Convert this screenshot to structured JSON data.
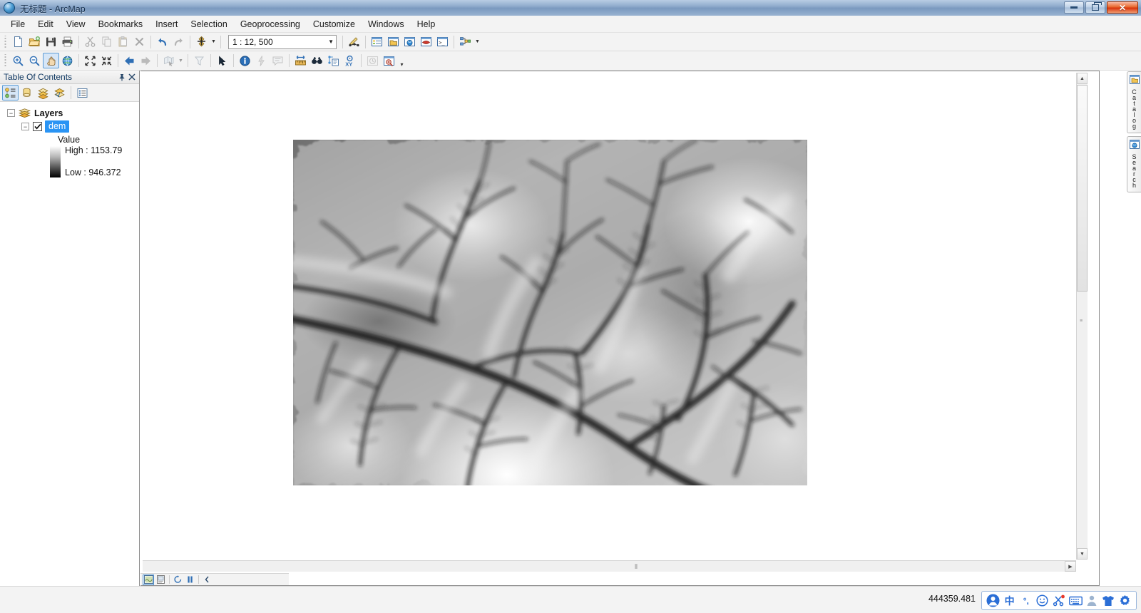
{
  "window": {
    "title": "无标题 - ArcMap",
    "app_icon": "arcmap-globe-icon",
    "controls": {
      "minimize": "minimize-button",
      "restore": "restore-button",
      "close": "✕"
    }
  },
  "menubar": {
    "items": [
      {
        "label": "File"
      },
      {
        "label": "Edit"
      },
      {
        "label": "View"
      },
      {
        "label": "Bookmarks"
      },
      {
        "label": "Insert"
      },
      {
        "label": "Selection"
      },
      {
        "label": "Geoprocessing"
      },
      {
        "label": "Customize"
      },
      {
        "label": "Windows"
      },
      {
        "label": "Help"
      }
    ]
  },
  "toolbars": {
    "standard": {
      "buttons": [
        {
          "name": "new-map-icon",
          "title": "New"
        },
        {
          "name": "open-icon",
          "title": "Open"
        },
        {
          "name": "save-icon",
          "title": "Save"
        },
        {
          "name": "print-icon",
          "title": "Print"
        },
        {
          "name": "cut-icon",
          "title": "Cut"
        },
        {
          "name": "copy-icon",
          "title": "Copy"
        },
        {
          "name": "paste-icon",
          "title": "Paste"
        },
        {
          "name": "delete-icon",
          "title": "Delete"
        },
        {
          "name": "undo-icon",
          "title": "Undo"
        },
        {
          "name": "redo-icon",
          "title": "Redo"
        },
        {
          "name": "add-data-icon",
          "title": "Add Data"
        }
      ],
      "scale": {
        "value": "1 : 12, 500",
        "placeholder": "1 : 12, 500"
      },
      "right_buttons": [
        {
          "name": "editor-toolbar-icon",
          "title": "Editor Toolbar"
        },
        {
          "name": "table-of-contents-icon",
          "title": "Table Of Contents"
        },
        {
          "name": "catalog-window-icon",
          "title": "Catalog Window"
        },
        {
          "name": "search-window-icon",
          "title": "Search Window"
        },
        {
          "name": "arctoolbox-icon",
          "title": "ArcToolbox"
        },
        {
          "name": "python-window-icon",
          "title": "Python Window"
        },
        {
          "name": "modelbuilder-icon",
          "title": "ModelBuilder"
        }
      ]
    },
    "tools": {
      "buttons": [
        {
          "name": "zoom-in-icon",
          "title": "Zoom In"
        },
        {
          "name": "zoom-out-icon",
          "title": "Zoom Out"
        },
        {
          "name": "pan-icon",
          "title": "Pan",
          "active": true
        },
        {
          "name": "full-extent-icon",
          "title": "Full Extent"
        },
        {
          "name": "fixed-zoom-in-icon",
          "title": "Fixed Zoom In"
        },
        {
          "name": "fixed-zoom-out-icon",
          "title": "Fixed Zoom Out"
        },
        {
          "name": "go-back-icon",
          "title": "Go Back To Previous Extent"
        },
        {
          "name": "go-forward-icon",
          "title": "Go To Next Extent"
        },
        {
          "name": "select-features-icon",
          "title": "Select Features"
        },
        {
          "name": "clear-selection-icon",
          "title": "Clear Selected Features"
        },
        {
          "name": "select-elements-icon",
          "title": "Select Elements"
        },
        {
          "name": "identify-icon",
          "title": "Identify"
        },
        {
          "name": "hyperlink-icon",
          "title": "Hyperlink"
        },
        {
          "name": "html-popup-icon",
          "title": "HTML Popup"
        },
        {
          "name": "measure-icon",
          "title": "Measure"
        },
        {
          "name": "find-icon",
          "title": "Find"
        },
        {
          "name": "find-route-icon",
          "title": "Find Route"
        },
        {
          "name": "go-to-xy-icon",
          "title": "Go To XY"
        },
        {
          "name": "time-slider-icon",
          "title": "Time Slider"
        },
        {
          "name": "create-viewer-window-icon",
          "title": "Create Viewer Window"
        }
      ]
    }
  },
  "toc": {
    "title": "Table Of Contents",
    "pin_icon": "pin-icon",
    "close_icon": "close-icon",
    "mode_buttons": [
      {
        "name": "list-by-drawing-order-icon",
        "title": "List By Drawing Order",
        "active": true
      },
      {
        "name": "list-by-source-icon",
        "title": "List By Source"
      },
      {
        "name": "list-by-visibility-icon",
        "title": "List By Visibility"
      },
      {
        "name": "list-by-selection-icon",
        "title": "List By Selection"
      },
      {
        "name": "toc-options-icon",
        "title": "Options"
      }
    ],
    "tree": {
      "root": {
        "label": "Layers",
        "expander": "−"
      },
      "layer": {
        "label": "dem",
        "expander": "−",
        "checked": true,
        "selected": true
      },
      "legend": {
        "value_label": "Value",
        "high_label": "High : 1153.79",
        "low_label": "Low : 946.372",
        "ramp_top_color": "#ffffff",
        "ramp_bottom_color": "#000000"
      }
    }
  },
  "map": {
    "raster_layer_name": "dem-raster",
    "background": "#ffffff",
    "bottom_bar": [
      {
        "name": "data-view-icon",
        "title": "Data View",
        "active": true
      },
      {
        "name": "layout-view-icon",
        "title": "Layout View"
      },
      {
        "name": "refresh-view-icon",
        "title": "Refresh View"
      },
      {
        "name": "pause-drawing-icon",
        "title": "Pause Drawing"
      },
      {
        "name": "collapse-panel-icon",
        "title": "Collapse"
      }
    ],
    "hscroll_grip": "⦀"
  },
  "dock_tabs": [
    {
      "label": "Catalog",
      "icon": "catalog-icon"
    },
    {
      "label": "Search",
      "icon": "search-icon"
    }
  ],
  "statusbar": {
    "coordinate": "444359.481",
    "ime": {
      "items": [
        {
          "name": "ime-logo-icon",
          "glyph": "user"
        },
        {
          "name": "ime-language-icon",
          "glyph": "中"
        },
        {
          "name": "ime-punctuation-icon",
          "glyph": "°,"
        },
        {
          "name": "ime-emoji-icon",
          "glyph": "smile"
        },
        {
          "name": "ime-screenshot-icon",
          "glyph": "scissors"
        },
        {
          "name": "ime-keyboard-icon",
          "glyph": "keyboard"
        },
        {
          "name": "ime-user-icon",
          "glyph": "person"
        },
        {
          "name": "ime-skin-icon",
          "glyph": "shirt"
        },
        {
          "name": "ime-settings-icon",
          "glyph": "gear"
        }
      ],
      "accent_color": "#2a6ed6"
    }
  }
}
